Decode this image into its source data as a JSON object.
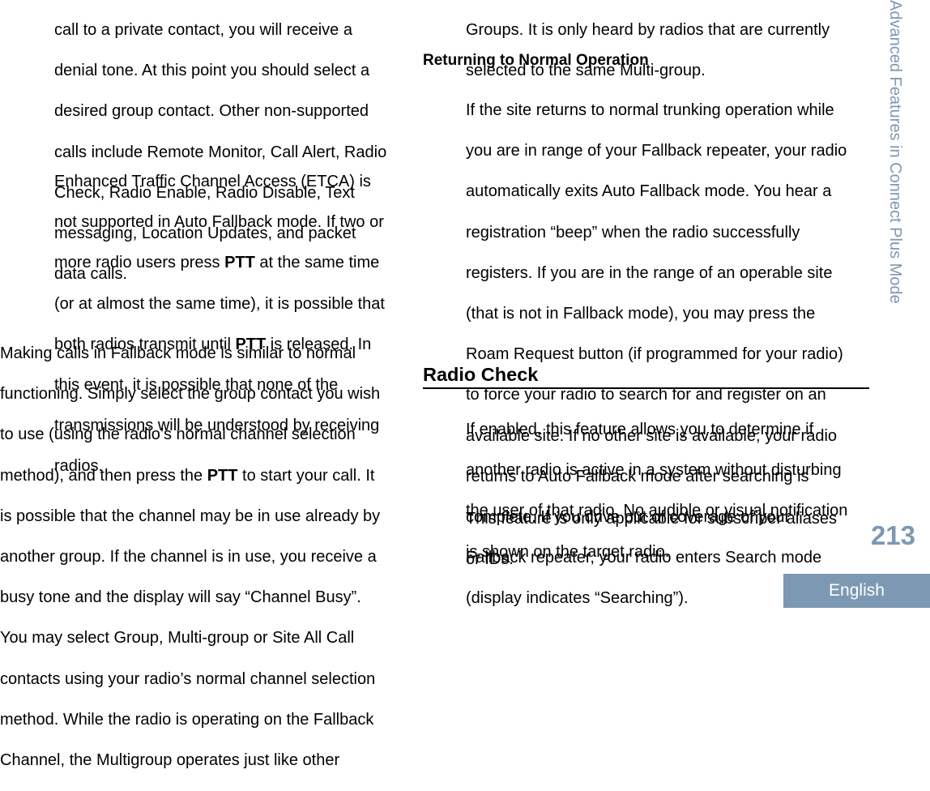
{
  "left_column": {
    "para1_lines": [
      "call to a private contact, you will receive a",
      "denial tone. At this point you should select a",
      "desired group contact. Other non-supported",
      "calls include Remote Monitor, Call Alert, Radio",
      "Check, Radio Enable, Radio Disable, Text",
      "messaging, Location Updates, and packet",
      "data calls."
    ],
    "para2": {
      "l1": "Enhanced Traffic Channel Access (ETCA) is",
      "l2": "not supported in Auto Fallback mode. If two or",
      "l3_pre": "more radio users press ",
      "l3_bold": "PTT",
      "l3_post": " at the same time",
      "l4": "(or at almost the same time), it is possible that",
      "l5_pre": "both radios transmit until ",
      "l5_bold": "PTT",
      "l5_post": " is released. In",
      "l6": "this event, it is possible that none of the",
      "l7": "transmissions will be understood by receiving",
      "l8": "radios."
    },
    "para3": {
      "l1": "Making calls in Fallback mode is similar to normal",
      "l2": "functioning. Simply select the group contact you wish",
      "l3": "to use (using the radio’s normal channel selection",
      "l4_pre": "method), and then press the ",
      "l4_bold": "PTT",
      "l4_post": " to start your call. It",
      "l5": "is possible that the channel may be in use already by",
      "l6": "another group. If the channel is in use, you receive a",
      "l7": "busy tone and the display will say “Channel Busy”.",
      "l8": "You may select Group, Multi-group or Site All Call",
      "l9": "contacts using your radio’s normal channel selection",
      "l10": "method. While the radio is operating on the Fallback",
      "l11": "Channel, the Multigroup operates just like other"
    }
  },
  "right_column": {
    "para1_lines": [
      "Groups. It is only heard by radios that are currently",
      "selected to the same Multi-group."
    ],
    "subheading": "Returning to Normal Operation",
    "para2_lines": [
      "If the site returns to normal trunking operation while",
      "you are in range of your Fallback repeater, your radio",
      "automatically exits Auto Fallback mode. You hear a",
      "registration “beep” when the radio successfully",
      "registers. If you are in the range of an operable site",
      "(that is not in Fallback mode), you may press the",
      "Roam Request button (if programmed for your radio)",
      "to force your radio to search for and register on an",
      "available site. If no other site is available, your radio",
      "returns to Auto Fallback mode after searching is",
      "complete. If you drive out of coverage of your",
      "Fallback repeater, your radio enters Search mode",
      "(display indicates “Searching”)."
    ],
    "section_heading": "Radio Check",
    "para3_lines": [
      "If enabled, this feature allows you to determine if",
      "another radio is active in a system without disturbing",
      "the user of that radio. No audible or visual notification",
      "is shown on the target radio."
    ],
    "para4_lines": [
      "This feature is only applicable for subscriber aliases",
      "or IDs."
    ]
  },
  "sidebar": {
    "chapter_title": "Advanced Features in Connect Plus Mode",
    "page_number": "213",
    "language": "English"
  },
  "colors": {
    "accent": "#7d98b3",
    "text": "#000000"
  }
}
